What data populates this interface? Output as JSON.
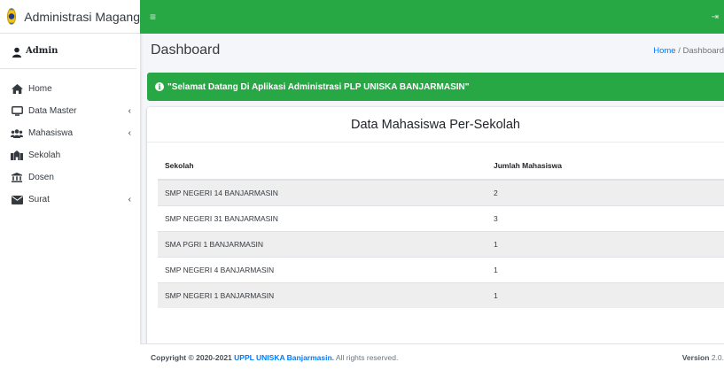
{
  "sidebar": {
    "brand": "Administrasi Magang",
    "user": "Admin",
    "items": [
      {
        "label": "Home",
        "icon": "home-icon",
        "arrow": ""
      },
      {
        "label": "Data Master",
        "icon": "desktop-icon",
        "arrow": "‹"
      },
      {
        "label": "Mahasiswa",
        "icon": "users-icon",
        "arrow": "‹"
      },
      {
        "label": "Sekolah",
        "icon": "school-icon",
        "arrow": ""
      },
      {
        "label": "Dosen",
        "icon": "university-icon",
        "arrow": ""
      },
      {
        "label": "Surat",
        "icon": "envelope-icon",
        "arrow": "‹"
      }
    ]
  },
  "topbar": {
    "menu_icon": "≡",
    "logout_icon": "⇥"
  },
  "header": {
    "title": "Dashboard",
    "breadcrumb_home": "Home",
    "breadcrumb_sep": " / ",
    "breadcrumb_current": "Dashboard"
  },
  "alert": {
    "text": "\"Selamat Datang Di Aplikasi Administrasi PLP UNISKA BANJARMASIN\""
  },
  "card": {
    "title": "Data Mahasiswa Per-Sekolah",
    "columns": [
      "Sekolah",
      "Jumlah Mahasiswa"
    ],
    "rows": [
      [
        "SMP NEGERI 14 BANJARMASIN",
        "2"
      ],
      [
        "SMP NEGERI 31 BANJARMASIN",
        "3"
      ],
      [
        "SMA PGRI 1 BANJARMASIN",
        "1"
      ],
      [
        "SMP NEGERI 4 BANJARMASIN",
        "1"
      ],
      [
        "SMP NEGERI 1 BANJARMASIN",
        "1"
      ]
    ]
  },
  "footer": {
    "copyright_prefix": "Copyright © 2020-2021 ",
    "org": "UPPL UNISKA Banjarmasin.",
    "suffix": " All rights reserved.",
    "version_label": "Version",
    "version": "2.0."
  },
  "colors": {
    "accent": "#28a745",
    "link": "#007bff"
  }
}
